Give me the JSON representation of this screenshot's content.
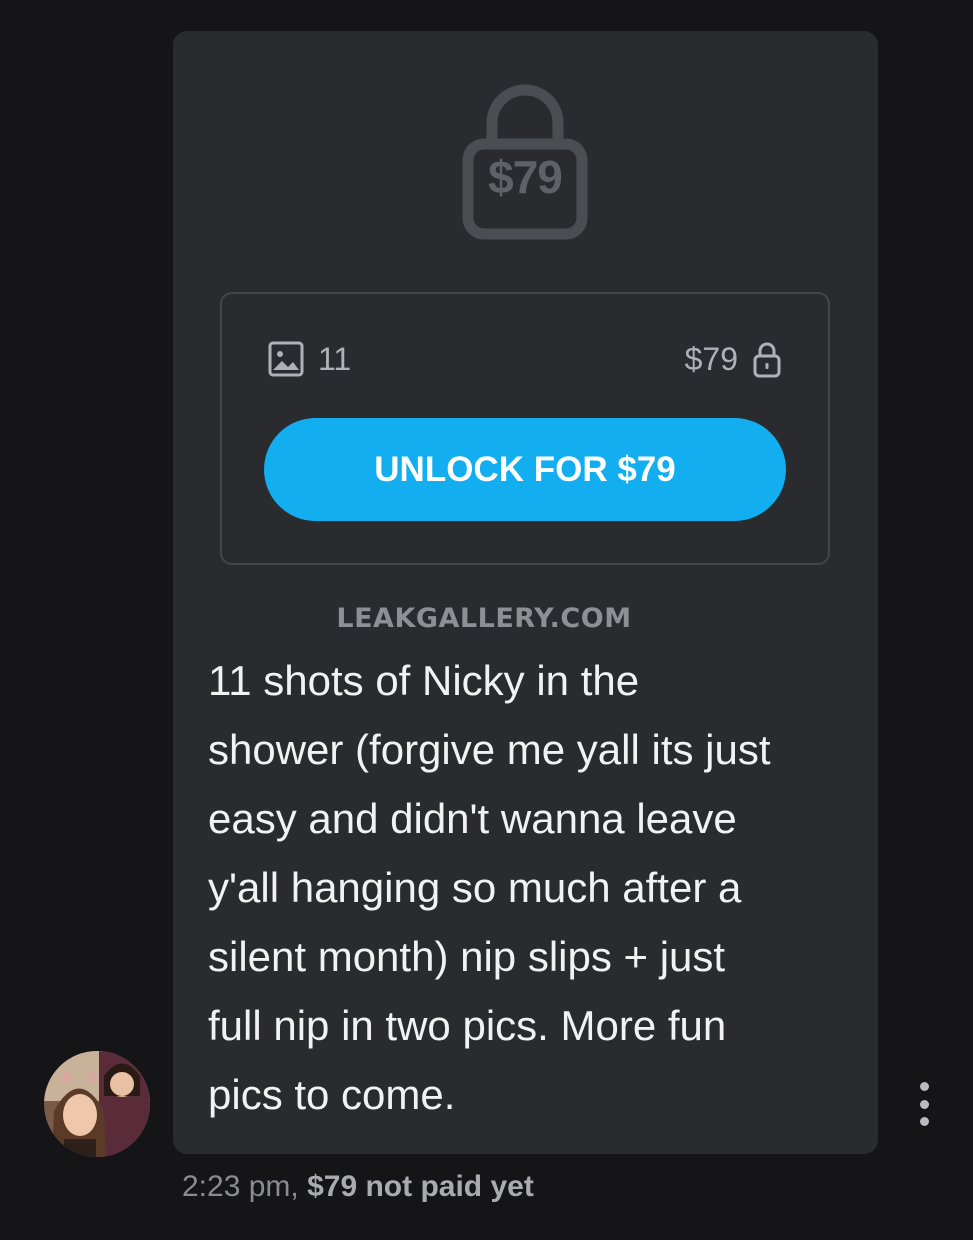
{
  "message": {
    "locked_price": "$79",
    "media": {
      "count": "11",
      "price": "$79"
    },
    "unlock_button": "UNLOCK FOR $79",
    "watermark": "LEAKGALLERY.COM",
    "caption": "11 shots of Nicky in the\nshower (forgive me yall its just\neasy and didn't wanna leave\ny'all hanging so much after a\nsilent month) nip slips + just\nfull nip in two pics. More fun\npics to come.",
    "time": "2:23 pm,",
    "status": "$79 not paid yet"
  },
  "colors": {
    "background": "#151517",
    "bubble": "#2a2b2e",
    "accent": "#12aef0",
    "muted": "#aeb1b7"
  },
  "icons": [
    "lock-icon",
    "image-icon",
    "small-lock-icon",
    "more-options-icon"
  ]
}
